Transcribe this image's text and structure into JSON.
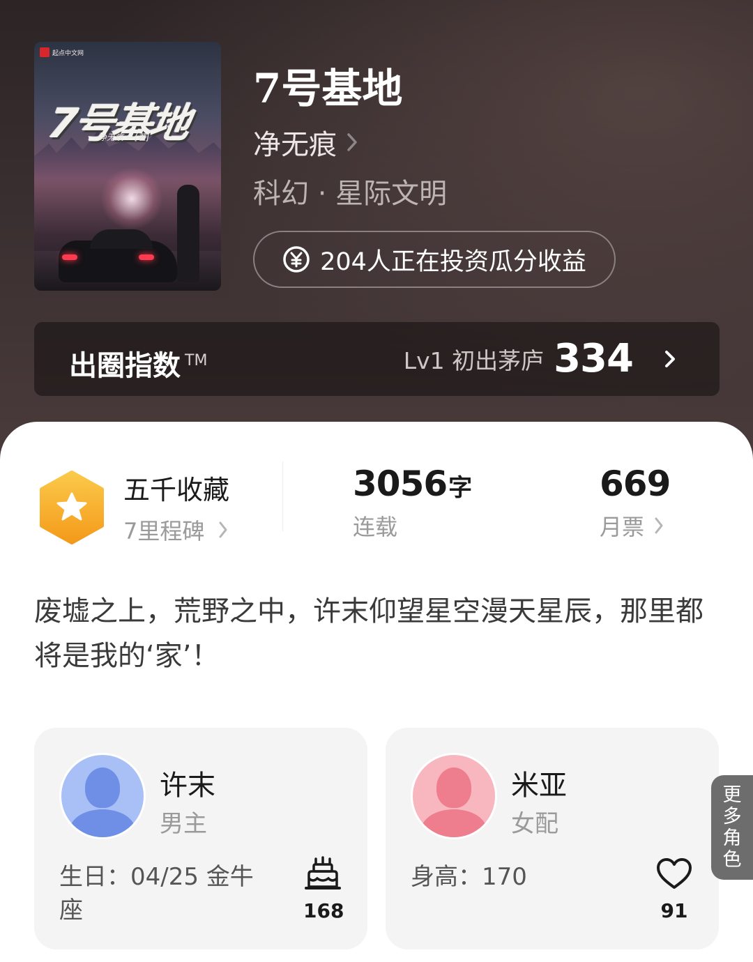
{
  "book": {
    "title": "7号基地",
    "author": "净无痕",
    "genre": "科幻 · 星际文明",
    "invest_text": "204人正在投资瓜分收益",
    "cover": {
      "title_art": "7号基地",
      "author_art": "净无痕 —[著]",
      "publisher": "起点中文网"
    }
  },
  "index": {
    "title": "出圈指数",
    "tm": "TM",
    "level": "Lv1 初出茅庐",
    "score": "334"
  },
  "stats": {
    "favorites": {
      "main": "五千收藏",
      "sub": "7里程碑"
    },
    "words": {
      "number": "3056",
      "unit": "字",
      "label": "连载"
    },
    "monthly_votes": {
      "number": "669",
      "label": "月票"
    }
  },
  "synopsis": "废墟之上，荒野之中，许末仰望星空漫天星辰，那里都将是我的‘家’！",
  "characters": [
    {
      "name": "许末",
      "role": "男主",
      "detail": "生日：04/25 金牛座",
      "count": "168",
      "icon": "birthday-cake-icon"
    },
    {
      "name": "米亚",
      "role": "女配",
      "detail": "身高：170",
      "count": "91",
      "icon": "heart-icon"
    }
  ],
  "more_roles": [
    "更",
    "多",
    "角",
    "色"
  ],
  "colors": {
    "header_bg": "#2c2425",
    "badge_gold": "#f7b52a",
    "male_avatar": "#8aa8f3",
    "female_avatar": "#f5a0ad"
  }
}
